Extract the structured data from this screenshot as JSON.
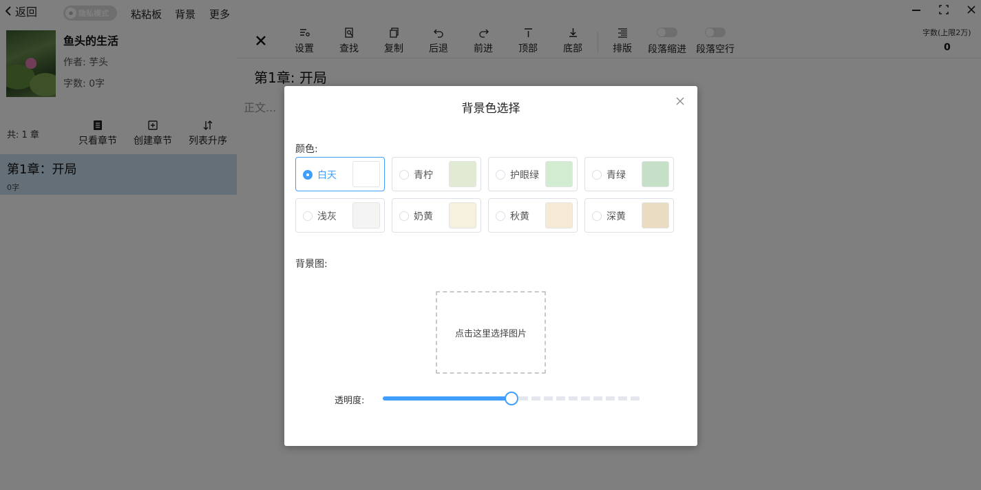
{
  "topbar": {
    "back_label": "返回",
    "privacy_label": "隐私模式",
    "menu": [
      "粘粘板",
      "背景",
      "更多"
    ]
  },
  "book": {
    "title": "鱼头的生活",
    "author": "作者: 芋头",
    "words": "字数: 0字"
  },
  "chapters_panel": {
    "count": "共: 1 章",
    "tools": [
      "只看章节",
      "创建章节",
      "列表升序"
    ],
    "items": [
      {
        "title": "第1章：开局",
        "words": "0字"
      }
    ]
  },
  "editor": {
    "toolbar": [
      "设置",
      "查找",
      "复制",
      "后退",
      "前进",
      "顶部",
      "底部",
      "排版"
    ],
    "toggles": [
      "段落缩进",
      "段落空行"
    ],
    "word_limit_label": "字数(上限2万)",
    "word_count": "0",
    "chapter_heading": "第1章: 开局",
    "body_placeholder": "正文..."
  },
  "dialog": {
    "title": "背景色选择",
    "color_label": "颜色:",
    "colors": [
      {
        "name": "白天",
        "hex": "#ffffff",
        "selected": true
      },
      {
        "name": "青柠",
        "hex": "#e1ebd3",
        "selected": false
      },
      {
        "name": "护眼绿",
        "hex": "#d2ecd2",
        "selected": false
      },
      {
        "name": "青绿",
        "hex": "#c6dfc7",
        "selected": false
      },
      {
        "name": "浅灰",
        "hex": "#f4f4f4",
        "selected": false
      },
      {
        "name": "奶黄",
        "hex": "#f6f1de",
        "selected": false
      },
      {
        "name": "秋黄",
        "hex": "#f6ead5",
        "selected": false
      },
      {
        "name": "深黄",
        "hex": "#e9dcc3",
        "selected": false
      }
    ],
    "bg_image_label": "背景图:",
    "upload_text": "点击这里选择图片",
    "opacity_label": "透明度:",
    "opacity_value": 0.5
  },
  "colors": {
    "accent": "#409eff",
    "selected_chapter_bg": "#c9dff0",
    "overlay": "rgba(0,0,0,0.5)"
  }
}
